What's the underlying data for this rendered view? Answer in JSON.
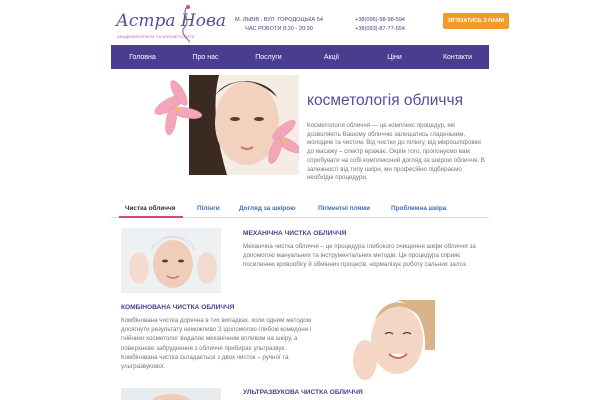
{
  "header": {
    "logo_text": "Астра Нова",
    "logo_sub": "АКАДЕМІЯ КРАСИ ТА КОСМЕТОЛОГІЇ",
    "address_line1": "М. ЛЬВІВ , ВУЛ. ГОРОДОЦЬКА 54",
    "address_line2": "ЧАС РОБОТИ 8:30 - 20:30",
    "phone1": "+38(096)-98-98-594",
    "phone2": "+38(093)-87-77-554",
    "cta_label": "ЗВ'ЯЗАТИСЬ З НАМИ"
  },
  "nav": [
    {
      "label": "Головна"
    },
    {
      "label": "Про нас"
    },
    {
      "label": "Послуги"
    },
    {
      "label": "Акції"
    },
    {
      "label": "Ціни"
    },
    {
      "label": "Контакти"
    }
  ],
  "hero": {
    "title": "косметологія обличчя",
    "text": "Косметологія обличчя — це комплекс процедур, які дозволяють Вашому обличчю залишатись гладеньким, молодим та чистим. Від чистки до пілінгу, від мікрошліфовки до масажу – спектр вражає. Окрім того, пропонуємо вам спробувати на собі комплексний догляд за шкірою обличчя. В залежності від типу шкіри, ми професійно підбираємо необхідні процедури."
  },
  "tabs": [
    {
      "label": "Чистка обличчя",
      "active": true
    },
    {
      "label": "Пілінги",
      "active": false
    },
    {
      "label": "Догляд за шкірою",
      "active": false
    },
    {
      "label": "Пігментні плями",
      "active": false
    },
    {
      "label": "Проблемна шкіра",
      "active": false
    }
  ],
  "sections": [
    {
      "title": "МЕХАНІЧНА ЧИСТКА ОБЛИЧЧЯ",
      "text": "Механічна чистка обличчя – це процедура глибокого очищення шкіри обличчя за допомогою мануальних та інструментальних методів. Ця процедура сприяє посиленню кровообігу й обмінних процесів, нормалізує роботу сальних залоз."
    },
    {
      "title": "КОМБІНОВАНА ЧИСТКА ОБЛИЧЧЯ",
      "text": "Комбінована чистка доречна в тих випадках, коли одним методом досягнути результату неможливо З ідоломогою глибокі комедони і гнійники косметолог видаляє механічним впливом на шкіру, а поверхневе забруднення з обличчя прибирає ультразвук. Комбінована чистка складається з двох чисток – ручної та ультразвукової."
    },
    {
      "title": "УЛЬТРАЗВУКОВА ЧИСТКА ОБЛИЧЧЯ"
    }
  ],
  "colors": {
    "brand": "#4a3c8e",
    "accent": "#f39a27",
    "tab_underline": "#e0407f",
    "link": "#3c6fb3"
  }
}
